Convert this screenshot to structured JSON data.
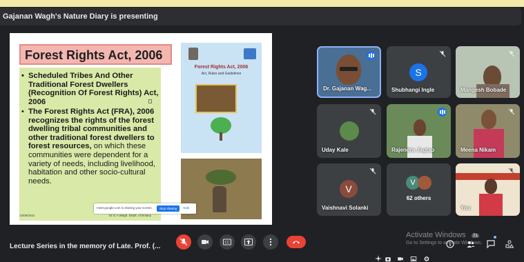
{
  "presenting_banner": "Gajanan Wagh's Nature Diary is presenting",
  "slide": {
    "title": "Forest Rights Act, 2006",
    "bullet1": "Scheduled Tribes And Other Traditional Forest Dwellers (Recognition Of Forest Rights) Act, 2006",
    "bullet2_bold": "The Forest Rights Act (FRA), 2006 recognizes the rights of the forest dwelling tribal communities and other traditional forest dwellers to forest resources,",
    "bullet2_rest": " on which these communities were dependent for a variety of needs, including livelihood, habitation and other socio-cultural needs.",
    "cover_title": "Forest Rights Act, 2006",
    "cover_subtitle": "Act, Rules and Guidelines",
    "footer_left": "10/08/2021",
    "footer_right": "Dr.G.A.Wagh, Deptt. of Botany",
    "share_popup_text": "meet.google.com is sharing your screen.",
    "stop_sharing": "Stop sharing",
    "hide": "Hide"
  },
  "participants": [
    {
      "name": "Dr. Gajanan Wag...",
      "speaking": true
    },
    {
      "name": "Shubhangi Ingle",
      "avatar_letter": "S",
      "avatar_color": "#1a73e8",
      "muted": true
    },
    {
      "name": "Mangesh Bobade",
      "muted": true
    },
    {
      "name": "Uday Kale",
      "muted": true
    },
    {
      "name": "Rajendra Jagtap",
      "speaking": true
    },
    {
      "name": "Meena Nikam",
      "muted": true
    },
    {
      "name": "Vaishnavi Solanki",
      "avatar_letter": "V",
      "avatar_color": "#8a4b3c",
      "muted": true
    },
    {
      "name": "62 others",
      "avatar_letter": "V",
      "avatar_color": "#4a8a7b"
    },
    {
      "name": "You",
      "muted": true
    }
  ],
  "bottom_bar": {
    "meeting_name": "Lecture Series in the memory of Late. Prof. (...",
    "participant_count": "71"
  },
  "watermark": {
    "line1": "Activate Windows",
    "line2": "Go to Settings to activate Windows."
  },
  "colors": {
    "end_call": "#ea4335",
    "speaking_blue": "#1a73e8",
    "tile_bg": "#3c4043",
    "bar_bg": "#202124"
  }
}
